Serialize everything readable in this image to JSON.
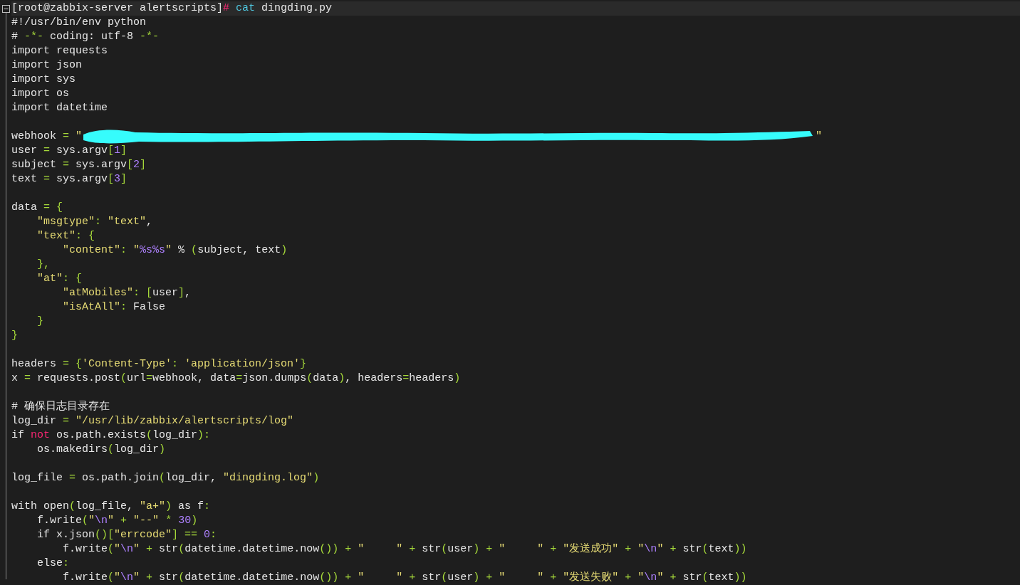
{
  "terminal": {
    "lines": [
      {
        "kind": "prompt",
        "tokens": [
          {
            "kind": "plain",
            "text": "[root@zabbix-server alertscripts]"
          },
          {
            "kind": "kw",
            "text": "#"
          },
          {
            "kind": "cmd",
            "text": " cat"
          },
          {
            "kind": "plain",
            "text": " dingding.py"
          }
        ]
      },
      {
        "kind": "code",
        "tokens": [
          {
            "kind": "plain",
            "text": "#!/usr/bin/env python"
          }
        ]
      },
      {
        "kind": "code",
        "tokens": [
          {
            "kind": "plain",
            "text": "# "
          },
          {
            "kind": "op",
            "text": "-*-"
          },
          {
            "kind": "plain",
            "text": " coding: utf-8 "
          },
          {
            "kind": "op",
            "text": "-*-"
          }
        ]
      },
      {
        "kind": "code",
        "tokens": [
          {
            "kind": "plain",
            "text": "import requests"
          }
        ]
      },
      {
        "kind": "code",
        "tokens": [
          {
            "kind": "plain",
            "text": "import json"
          }
        ]
      },
      {
        "kind": "code",
        "tokens": [
          {
            "kind": "plain",
            "text": "import sys"
          }
        ]
      },
      {
        "kind": "code",
        "tokens": [
          {
            "kind": "plain",
            "text": "import os"
          }
        ]
      },
      {
        "kind": "code",
        "tokens": [
          {
            "kind": "plain",
            "text": "import datetime"
          }
        ]
      },
      {
        "kind": "blank"
      },
      {
        "kind": "code",
        "tokens": [
          {
            "kind": "plain",
            "text": "webhook "
          },
          {
            "kind": "op",
            "text": "= "
          },
          {
            "kind": "str",
            "text": "\""
          },
          {
            "kind": "redaction"
          },
          {
            "kind": "str",
            "text": "\""
          }
        ]
      },
      {
        "kind": "code",
        "tokens": [
          {
            "kind": "plain",
            "text": "user "
          },
          {
            "kind": "op",
            "text": "="
          },
          {
            "kind": "plain",
            "text": " sys.argv"
          },
          {
            "kind": "op",
            "text": "["
          },
          {
            "kind": "num",
            "text": "1"
          },
          {
            "kind": "op",
            "text": "]"
          }
        ]
      },
      {
        "kind": "code",
        "tokens": [
          {
            "kind": "plain",
            "text": "subject "
          },
          {
            "kind": "op",
            "text": "="
          },
          {
            "kind": "plain",
            "text": " sys.argv"
          },
          {
            "kind": "op",
            "text": "["
          },
          {
            "kind": "num",
            "text": "2"
          },
          {
            "kind": "op",
            "text": "]"
          }
        ]
      },
      {
        "kind": "code",
        "tokens": [
          {
            "kind": "plain",
            "text": "text "
          },
          {
            "kind": "op",
            "text": "="
          },
          {
            "kind": "plain",
            "text": " sys.argv"
          },
          {
            "kind": "op",
            "text": "["
          },
          {
            "kind": "num",
            "text": "3"
          },
          {
            "kind": "op",
            "text": "]"
          }
        ]
      },
      {
        "kind": "blank"
      },
      {
        "kind": "code",
        "tokens": [
          {
            "kind": "plain",
            "text": "data "
          },
          {
            "kind": "op",
            "text": "= {"
          }
        ]
      },
      {
        "kind": "code",
        "tokens": [
          {
            "kind": "str",
            "text": "    \"msgtype\""
          },
          {
            "kind": "op",
            "text": ": "
          },
          {
            "kind": "str",
            "text": "\"text\""
          },
          {
            "kind": "plain",
            "text": ","
          }
        ]
      },
      {
        "kind": "code",
        "tokens": [
          {
            "kind": "str",
            "text": "    \"text\""
          },
          {
            "kind": "op",
            "text": ": {"
          }
        ]
      },
      {
        "kind": "code",
        "tokens": [
          {
            "kind": "str",
            "text": "        \"content\""
          },
          {
            "kind": "op",
            "text": ": "
          },
          {
            "kind": "str",
            "text": "\""
          },
          {
            "kind": "num",
            "text": "%s%s"
          },
          {
            "kind": "str",
            "text": "\""
          },
          {
            "kind": "plain",
            "text": " % "
          },
          {
            "kind": "op",
            "text": "("
          },
          {
            "kind": "plain",
            "text": "subject, text"
          },
          {
            "kind": "op",
            "text": ")"
          }
        ]
      },
      {
        "kind": "code",
        "tokens": [
          {
            "kind": "op",
            "text": "    },"
          }
        ]
      },
      {
        "kind": "code",
        "tokens": [
          {
            "kind": "str",
            "text": "    \"at\""
          },
          {
            "kind": "op",
            "text": ": {"
          }
        ]
      },
      {
        "kind": "code",
        "tokens": [
          {
            "kind": "str",
            "text": "        \"atMobiles\""
          },
          {
            "kind": "op",
            "text": ": ["
          },
          {
            "kind": "plain",
            "text": "user"
          },
          {
            "kind": "op",
            "text": "]"
          },
          {
            "kind": "plain",
            "text": ","
          }
        ]
      },
      {
        "kind": "code",
        "tokens": [
          {
            "kind": "str",
            "text": "        \"isAtAll\""
          },
          {
            "kind": "op",
            "text": ":"
          },
          {
            "kind": "plain",
            "text": " False"
          }
        ]
      },
      {
        "kind": "code",
        "tokens": [
          {
            "kind": "op",
            "text": "    }"
          }
        ]
      },
      {
        "kind": "code",
        "tokens": [
          {
            "kind": "op",
            "text": "}"
          }
        ]
      },
      {
        "kind": "blank"
      },
      {
        "kind": "code",
        "tokens": [
          {
            "kind": "plain",
            "text": "headers "
          },
          {
            "kind": "op",
            "text": "= {"
          },
          {
            "kind": "str",
            "text": "'Content-Type'"
          },
          {
            "kind": "op",
            "text": ": "
          },
          {
            "kind": "str",
            "text": "'application/json'"
          },
          {
            "kind": "op",
            "text": "}"
          }
        ]
      },
      {
        "kind": "code",
        "tokens": [
          {
            "kind": "plain",
            "text": "x "
          },
          {
            "kind": "op",
            "text": "="
          },
          {
            "kind": "plain",
            "text": " requests.post"
          },
          {
            "kind": "op",
            "text": "("
          },
          {
            "kind": "plain",
            "text": "url"
          },
          {
            "kind": "op",
            "text": "="
          },
          {
            "kind": "plain",
            "text": "webhook, data"
          },
          {
            "kind": "op",
            "text": "="
          },
          {
            "kind": "plain",
            "text": "json.dumps"
          },
          {
            "kind": "op",
            "text": "("
          },
          {
            "kind": "plain",
            "text": "data"
          },
          {
            "kind": "op",
            "text": ")"
          },
          {
            "kind": "plain",
            "text": ", headers"
          },
          {
            "kind": "op",
            "text": "="
          },
          {
            "kind": "plain",
            "text": "headers"
          },
          {
            "kind": "op",
            "text": ")"
          }
        ]
      },
      {
        "kind": "blank"
      },
      {
        "kind": "code",
        "tokens": [
          {
            "kind": "plain",
            "text": "# 确保日志目录存在"
          }
        ]
      },
      {
        "kind": "code",
        "tokens": [
          {
            "kind": "plain",
            "text": "log_dir "
          },
          {
            "kind": "op",
            "text": "= "
          },
          {
            "kind": "str",
            "text": "\"/usr/lib/zabbix/alertscripts/log\""
          }
        ]
      },
      {
        "kind": "code",
        "tokens": [
          {
            "kind": "plain",
            "text": "if "
          },
          {
            "kind": "kw",
            "text": "not"
          },
          {
            "kind": "plain",
            "text": " os.path.exists"
          },
          {
            "kind": "op",
            "text": "("
          },
          {
            "kind": "plain",
            "text": "log_dir"
          },
          {
            "kind": "op",
            "text": "):"
          }
        ]
      },
      {
        "kind": "code",
        "tokens": [
          {
            "kind": "plain",
            "text": "    os.makedirs"
          },
          {
            "kind": "op",
            "text": "("
          },
          {
            "kind": "plain",
            "text": "log_dir"
          },
          {
            "kind": "op",
            "text": ")"
          }
        ]
      },
      {
        "kind": "blank"
      },
      {
        "kind": "code",
        "tokens": [
          {
            "kind": "plain",
            "text": "log_file "
          },
          {
            "kind": "op",
            "text": "="
          },
          {
            "kind": "plain",
            "text": " os.path.join"
          },
          {
            "kind": "op",
            "text": "("
          },
          {
            "kind": "plain",
            "text": "log_dir, "
          },
          {
            "kind": "str",
            "text": "\"dingding.log\""
          },
          {
            "kind": "op",
            "text": ")"
          }
        ]
      },
      {
        "kind": "blank"
      },
      {
        "kind": "code",
        "tokens": [
          {
            "kind": "plain",
            "text": "with open"
          },
          {
            "kind": "op",
            "text": "("
          },
          {
            "kind": "plain",
            "text": "log_file, "
          },
          {
            "kind": "str",
            "text": "\"a+\""
          },
          {
            "kind": "op",
            "text": ")"
          },
          {
            "kind": "plain",
            "text": " as f"
          },
          {
            "kind": "op",
            "text": ":"
          }
        ]
      },
      {
        "kind": "code",
        "tokens": [
          {
            "kind": "plain",
            "text": "    f.write"
          },
          {
            "kind": "op",
            "text": "("
          },
          {
            "kind": "str",
            "text": "\""
          },
          {
            "kind": "num",
            "text": "\\n"
          },
          {
            "kind": "str",
            "text": "\""
          },
          {
            "kind": "op",
            "text": " + "
          },
          {
            "kind": "str",
            "text": "\"--\""
          },
          {
            "kind": "op",
            "text": " * "
          },
          {
            "kind": "num",
            "text": "30"
          },
          {
            "kind": "op",
            "text": ")"
          }
        ]
      },
      {
        "kind": "code",
        "tokens": [
          {
            "kind": "plain",
            "text": "    if x.json"
          },
          {
            "kind": "op",
            "text": "()["
          },
          {
            "kind": "str",
            "text": "\"errcode\""
          },
          {
            "kind": "op",
            "text": "] == "
          },
          {
            "kind": "num",
            "text": "0"
          },
          {
            "kind": "op",
            "text": ":"
          }
        ]
      },
      {
        "kind": "code",
        "tokens": [
          {
            "kind": "plain",
            "text": "        f.write"
          },
          {
            "kind": "op",
            "text": "("
          },
          {
            "kind": "str",
            "text": "\""
          },
          {
            "kind": "num",
            "text": "\\n"
          },
          {
            "kind": "str",
            "text": "\""
          },
          {
            "kind": "op",
            "text": " +"
          },
          {
            "kind": "plain",
            "text": " str"
          },
          {
            "kind": "op",
            "text": "("
          },
          {
            "kind": "plain",
            "text": "datetime.datetime.now"
          },
          {
            "kind": "op",
            "text": "()) + "
          },
          {
            "kind": "str",
            "text": "\"     \""
          },
          {
            "kind": "op",
            "text": " +"
          },
          {
            "kind": "plain",
            "text": " str"
          },
          {
            "kind": "op",
            "text": "("
          },
          {
            "kind": "plain",
            "text": "user"
          },
          {
            "kind": "op",
            "text": ") + "
          },
          {
            "kind": "str",
            "text": "\"     \""
          },
          {
            "kind": "op",
            "text": " + "
          },
          {
            "kind": "str",
            "text": "\"发送成功\""
          },
          {
            "kind": "op",
            "text": " + "
          },
          {
            "kind": "str",
            "text": "\""
          },
          {
            "kind": "num",
            "text": "\\n"
          },
          {
            "kind": "str",
            "text": "\""
          },
          {
            "kind": "op",
            "text": " +"
          },
          {
            "kind": "plain",
            "text": " str"
          },
          {
            "kind": "op",
            "text": "("
          },
          {
            "kind": "plain",
            "text": "text"
          },
          {
            "kind": "op",
            "text": "))"
          }
        ]
      },
      {
        "kind": "code",
        "tokens": [
          {
            "kind": "plain",
            "text": "    else"
          },
          {
            "kind": "op",
            "text": ":"
          }
        ]
      },
      {
        "kind": "code",
        "tokens": [
          {
            "kind": "plain",
            "text": "        f.write"
          },
          {
            "kind": "op",
            "text": "("
          },
          {
            "kind": "str",
            "text": "\""
          },
          {
            "kind": "num",
            "text": "\\n"
          },
          {
            "kind": "str",
            "text": "\""
          },
          {
            "kind": "op",
            "text": " +"
          },
          {
            "kind": "plain",
            "text": " str"
          },
          {
            "kind": "op",
            "text": "("
          },
          {
            "kind": "plain",
            "text": "datetime.datetime.now"
          },
          {
            "kind": "op",
            "text": "()) + "
          },
          {
            "kind": "str",
            "text": "\"     \""
          },
          {
            "kind": "op",
            "text": " +"
          },
          {
            "kind": "plain",
            "text": " str"
          },
          {
            "kind": "op",
            "text": "("
          },
          {
            "kind": "plain",
            "text": "user"
          },
          {
            "kind": "op",
            "text": ") + "
          },
          {
            "kind": "str",
            "text": "\"     \""
          },
          {
            "kind": "op",
            "text": " + "
          },
          {
            "kind": "str",
            "text": "\"发送失败\""
          },
          {
            "kind": "op",
            "text": " + "
          },
          {
            "kind": "str",
            "text": "\""
          },
          {
            "kind": "num",
            "text": "\\n"
          },
          {
            "kind": "str",
            "text": "\""
          },
          {
            "kind": "op",
            "text": " +"
          },
          {
            "kind": "plain",
            "text": " str"
          },
          {
            "kind": "op",
            "text": "("
          },
          {
            "kind": "plain",
            "text": "text"
          },
          {
            "kind": "op",
            "text": "))"
          }
        ]
      }
    ]
  }
}
